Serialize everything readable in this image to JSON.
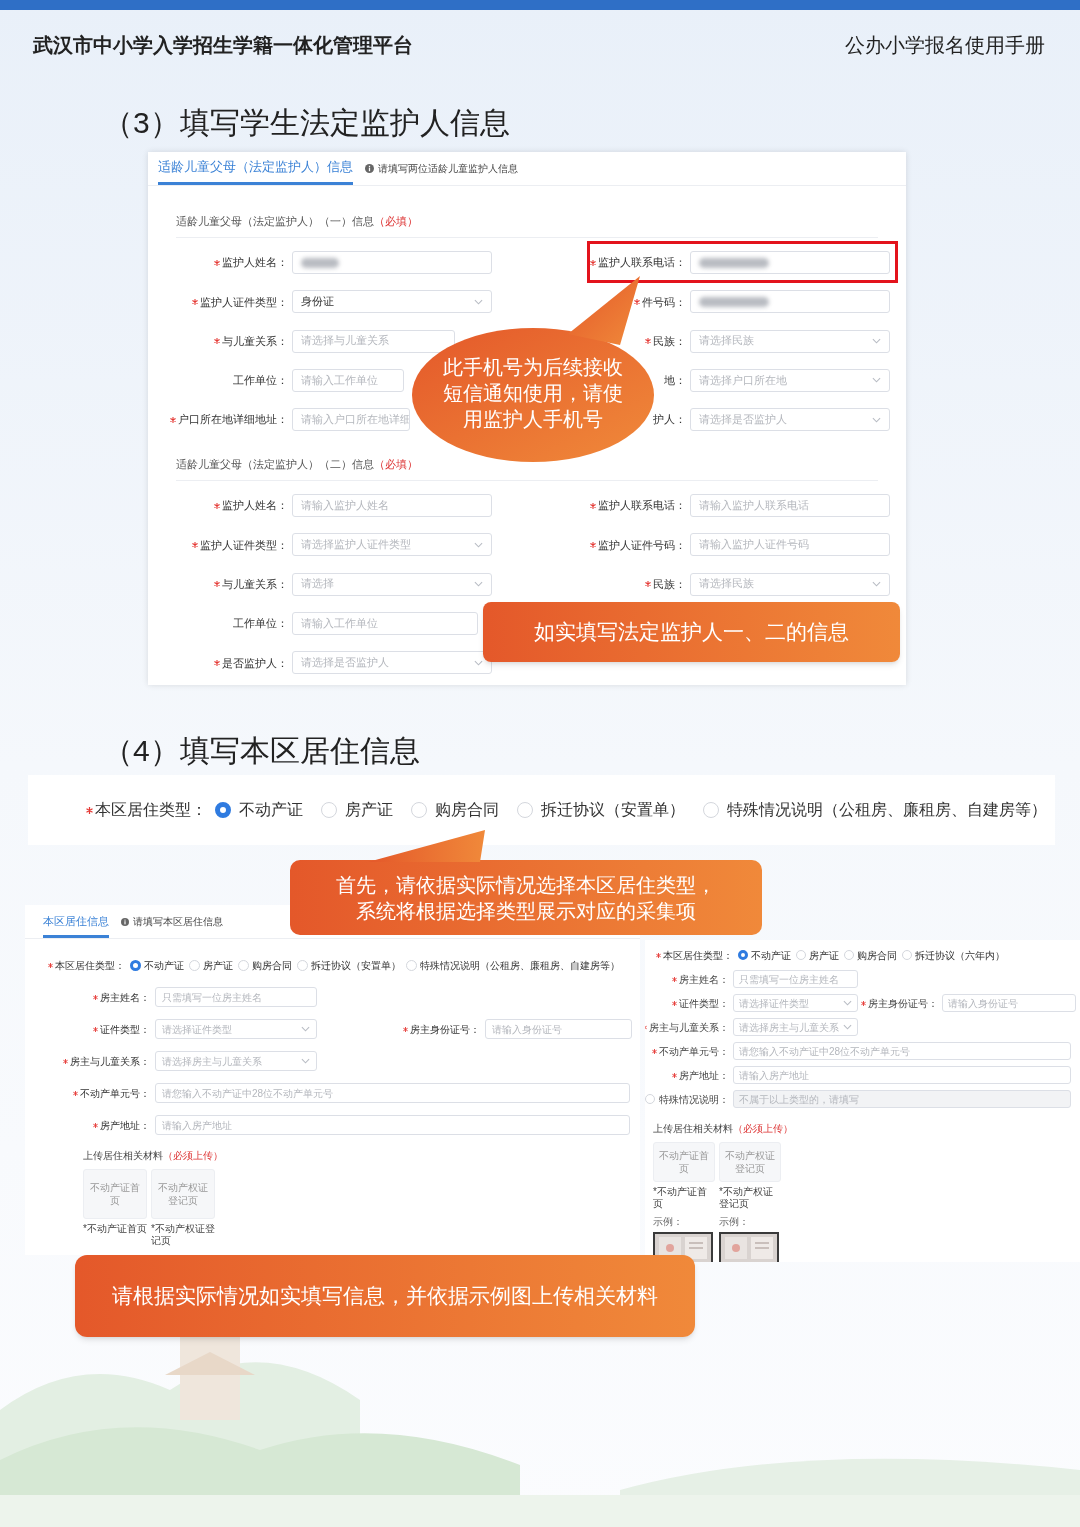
{
  "header": {
    "platform": "武汉市中小学入学招生学籍一体化管理平台",
    "manual": "公办小学报名使用手册"
  },
  "guardian_step": {
    "heading": "（3）填写学生法定监护人信息",
    "tabs": [
      {
        "label": "适龄儿童父母（法定监护人）信息",
        "selected": true
      }
    ],
    "tab_hint": "请填写两位适龄儿童监护人信息",
    "groups": [
      {
        "title": "适龄儿童父母（法定监护人）（一）信息",
        "required_note": "（必填）",
        "rows": [
          [
            {
              "label": "监护人姓名：",
              "required": true,
              "kind": "input",
              "redacted": true
            },
            {
              "label": "监护人联系电话：",
              "required": true,
              "kind": "input",
              "redacted": true,
              "highlighted": true
            }
          ],
          [
            {
              "label": "监护人证件类型：",
              "required": true,
              "kind": "select",
              "value": "身份证"
            },
            {
              "label": "件号码：",
              "required": true,
              "kind": "input",
              "redacted": true
            }
          ],
          [
            {
              "label": "与儿童关系：",
              "required": true,
              "kind": "select",
              "placeholder": "请选择与儿童关系"
            },
            {
              "label": "民族：",
              "required": true,
              "kind": "select",
              "placeholder": "请选择民族"
            }
          ],
          [
            {
              "label": "工作单位：",
              "required": false,
              "kind": "input",
              "placeholder": "请输入工作单位"
            },
            {
              "label": "地：",
              "required": false,
              "kind": "select",
              "placeholder": "请选择户口所在地"
            }
          ],
          [
            {
              "label": "户口所在地详细地址：",
              "required": true,
              "kind": "input",
              "placeholder": "请输入户口所在地详细"
            },
            {
              "label": "护人：",
              "required": false,
              "kind": "select",
              "placeholder": "请选择是否监护人"
            }
          ]
        ]
      },
      {
        "title": "适龄儿童父母（法定监护人）（二）信息",
        "required_note": "（必填）",
        "rows": [
          [
            {
              "label": "监护人姓名：",
              "required": true,
              "kind": "input",
              "placeholder": "请输入监护人姓名"
            },
            {
              "label": "监护人联系电话：",
              "required": true,
              "kind": "input",
              "placeholder": "请输入监护人联系电话"
            }
          ],
          [
            {
              "label": "监护人证件类型：",
              "required": true,
              "kind": "select",
              "placeholder": "请选择监护人证件类型"
            },
            {
              "label": "监护人证件号码：",
              "required": true,
              "kind": "input",
              "placeholder": "请输入监护人证件号码"
            }
          ],
          [
            {
              "label": "与儿童关系：",
              "required": true,
              "kind": "select",
              "placeholder": "请选择"
            },
            {
              "label": "民族：",
              "required": true,
              "kind": "select",
              "placeholder": "请选择民族"
            }
          ],
          [
            {
              "label": "工作单位：",
              "required": false,
              "kind": "input",
              "placeholder": "请输入工作单位"
            }
          ],
          [
            {
              "label": "是否监护人：",
              "required": true,
              "kind": "select",
              "placeholder": "请选择是否监护人"
            }
          ]
        ]
      }
    ],
    "bubble": [
      "此手机号为后续接收",
      "短信通知使用，请使",
      "用监护人手机号"
    ],
    "banner": "如实填写法定监护人一、二的信息"
  },
  "residence_step": {
    "heading": "（4）填写本区居住信息",
    "type_selector": {
      "label": "本区居住类型：",
      "required": true,
      "options": [
        {
          "label": "不动产证",
          "selected": true
        },
        {
          "label": "房产证",
          "selected": false
        },
        {
          "label": "购房合同",
          "selected": false
        },
        {
          "label": "拆迁协议（安置单）",
          "selected": false
        },
        {
          "label": "特殊情况说明（公租房、廉租房、自建房等）",
          "selected": false
        }
      ]
    },
    "callout": [
      "首先，请依据实际情况选择本区居住类型，",
      "系统将根据选择类型展示对应的采集项"
    ],
    "forms": [
      {
        "tabs": [
          {
            "label": "本区居住信息",
            "selected": true
          }
        ],
        "tab_hint": "请填写本区居住信息",
        "type_label": "本区居住类型：",
        "type_required": true,
        "options": [
          {
            "label": "不动产证",
            "selected": true
          },
          {
            "label": "房产证",
            "selected": false
          },
          {
            "label": "购房合同",
            "selected": false
          },
          {
            "label": "拆迁协议（安置单）",
            "selected": false
          },
          {
            "label": "特殊情况说明（公租房、廉租房、自建房等）",
            "selected": false
          }
        ],
        "rows": [
          [
            {
              "label": "房主姓名：",
              "required": true,
              "kind": "input",
              "placeholder": "只需填写一位房主姓名"
            }
          ],
          [
            {
              "label": "证件类型：",
              "required": true,
              "kind": "select",
              "placeholder": "请选择证件类型"
            },
            {
              "label": "房主身份证号：",
              "required": true,
              "kind": "input",
              "placeholder": "请输入身份证号"
            }
          ],
          [
            {
              "label": "房主与儿童关系：",
              "required": true,
              "kind": "select",
              "placeholder": "请选择房主与儿童关系"
            }
          ],
          [
            {
              "label": "不动产单元号：",
              "required": true,
              "kind": "wide_input",
              "placeholder": "请您输入不动产证中28位不动产单元号"
            }
          ],
          [
            {
              "label": "房产地址：",
              "required": true,
              "kind": "wide_input",
              "placeholder": "请输入房产地址"
            }
          ]
        ],
        "upload": {
          "title": "上传居住相关材料",
          "required_note": "（必须上传）",
          "slots": [
            {
              "label": "不动产证首页",
              "caption": "*不动产证首页"
            },
            {
              "label": "不动产权证登记页",
              "caption": "*不动产权证登记页"
            }
          ]
        }
      },
      {
        "type_label": "本区居住类型：",
        "type_required": true,
        "options": [
          {
            "label": "不动产证",
            "selected": true
          },
          {
            "label": "房产证",
            "selected": false
          },
          {
            "label": "购房合同",
            "selected": false
          },
          {
            "label": "拆迁协议（六年内）",
            "selected": false
          }
        ],
        "rows": [
          [
            {
              "label": "房主姓名：",
              "required": true,
              "kind": "input",
              "placeholder": "只需填写一位房主姓名"
            }
          ],
          [
            {
              "label": "证件类型：",
              "required": true,
              "kind": "select",
              "placeholder": "请选择证件类型"
            },
            {
              "label": "房主身份证号：",
              "required": true,
              "kind": "input",
              "placeholder": "请输入身份证号"
            }
          ],
          [
            {
              "label": "房主与儿童关系：",
              "required": true,
              "kind": "select",
              "placeholder": "请选择房主与儿童关系"
            }
          ],
          [
            {
              "label": "不动产单元号：",
              "required": true,
              "kind": "wide_input",
              "placeholder": "请您输入不动产证中28位不动产单元号"
            }
          ],
          [
            {
              "label": "房产地址：",
              "required": true,
              "kind": "wide_input",
              "placeholder": "请输入房产地址"
            }
          ],
          [
            {
              "label": "特殊情况说明：",
              "required": false,
              "kind": "wide_input",
              "checked": false,
              "disabled": true,
              "placeholder": "不属于以上类型的，请填写"
            }
          ]
        ],
        "upload": {
          "title": "上传居住相关材料",
          "required_note": "（必须上传）",
          "slots": [
            {
              "label": "不动产证首页",
              "caption": "*不动产证首页",
              "example_label": "示例："
            },
            {
              "label": "不动产权证登记页",
              "caption": "*不动产权证登记页",
              "example_label": "示例："
            }
          ]
        }
      }
    ],
    "banner": "请根据实际情况如实填写信息，并依据示例图上传相关材料"
  }
}
